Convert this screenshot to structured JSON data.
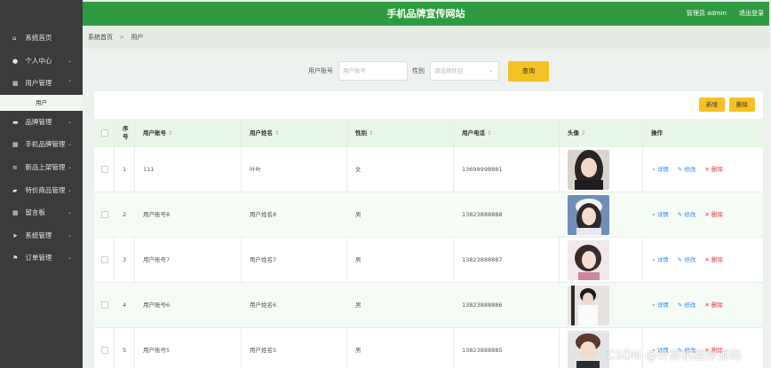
{
  "header": {
    "title": "手机品牌宣传网站",
    "user_label": "管理员 admin",
    "logout_label": "退出登录"
  },
  "sidebar": {
    "items": [
      {
        "label": "系统首页",
        "icon": "home-icon",
        "glyph": "⌂",
        "chevron": ""
      },
      {
        "label": "个人中心",
        "icon": "person-icon",
        "glyph": "●",
        "chevron": "⌄"
      },
      {
        "label": "用户管理",
        "icon": "grid-icon",
        "glyph": "▦",
        "chevron": "⌃"
      },
      {
        "label": "品牌管理",
        "icon": "box-icon",
        "glyph": "▬",
        "chevron": "⌄"
      },
      {
        "label": "手机品牌管理",
        "icon": "grid-icon",
        "glyph": "▦",
        "chevron": "⌄"
      },
      {
        "label": "新品上架管理",
        "icon": "sliders-icon",
        "glyph": "≡",
        "chevron": "⌄"
      },
      {
        "label": "特价商品管理",
        "icon": "chat-icon",
        "glyph": "▰",
        "chevron": "⌄"
      },
      {
        "label": "留言板",
        "icon": "grid-icon",
        "glyph": "▦",
        "chevron": "⌄"
      },
      {
        "label": "系统管理",
        "icon": "send-icon",
        "glyph": "➤",
        "chevron": "⌄"
      },
      {
        "label": "订单管理",
        "icon": "flag-icon",
        "glyph": "⚑",
        "chevron": "⌄"
      }
    ],
    "sub_item": "用户"
  },
  "breadcrumb": {
    "home": "系统首页",
    "separator": ">",
    "current": "用户"
  },
  "search": {
    "account_label": "用户账号",
    "account_placeholder": "用户账号",
    "gender_label": "性别",
    "gender_placeholder": "请选择性别",
    "query_button": "查询"
  },
  "toolbar": {
    "add_label": "新增",
    "delete_label": "删除"
  },
  "table": {
    "columns": [
      "序号",
      "用户账号",
      "用户姓名",
      "性别",
      "用户电话",
      "头像",
      "操作"
    ],
    "seq_line1": "序",
    "seq_line2": "号",
    "sort_glyph": "⇕",
    "rows": [
      {
        "seq": "1",
        "account": "111",
        "name": "叶叶",
        "gender": "女",
        "phone": "13699998881"
      },
      {
        "seq": "2",
        "account": "用户账号8",
        "name": "用户姓名8",
        "gender": "男",
        "phone": "13823888888"
      },
      {
        "seq": "3",
        "account": "用户账号7",
        "name": "用户姓名7",
        "gender": "男",
        "phone": "13823888887"
      },
      {
        "seq": "4",
        "account": "用户账号6",
        "name": "用户姓名6",
        "gender": "男",
        "phone": "13823888886"
      },
      {
        "seq": "5",
        "account": "用户账号5",
        "name": "用户姓名5",
        "gender": "男",
        "phone": "13823888885"
      }
    ],
    "actions": {
      "detail": "详情",
      "edit": "修改",
      "delete": "删除"
    }
  },
  "watermark": "CSDN @计算机程序源码",
  "colors": {
    "header": "#2f9b40",
    "sidebar": "#3b3b3b",
    "button": "#f5c125",
    "table_header": "#e8f6e8",
    "link": "#2d8cf0",
    "danger": "#e33333"
  }
}
